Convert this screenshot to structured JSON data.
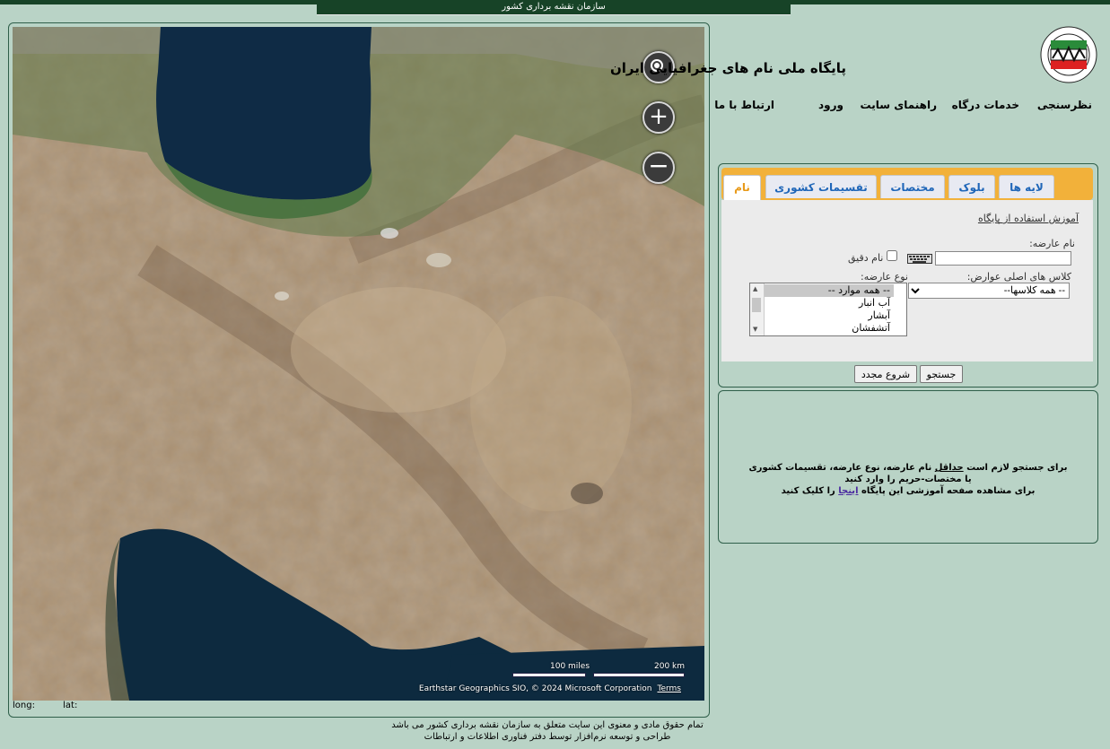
{
  "banner": {
    "agency": "سازمان نقشه برداری کشور"
  },
  "header": {
    "title": "پایگاه ملی نام های جغرافیایی ایران",
    "nav": [
      "نظرسنجی",
      "خدمات درگاه",
      "راهنمای سایت",
      "ورود",
      "ارتباط با ما"
    ]
  },
  "map": {
    "scale_miles": "100 miles",
    "scale_km": "200 km",
    "attribution": "Earthstar Geographics SIO, © 2024 Microsoft Corporation",
    "terms": "Terms",
    "zoom_in": "+",
    "zoom_out": "−",
    "long_label": "long:",
    "lat_label": "lat:"
  },
  "search": {
    "tabs": [
      "نام",
      "تقسیمات کشوری",
      "مختصات",
      "بلوک",
      "لایه ها"
    ],
    "active_tab": "نام",
    "help_link": "آموزش استفاده از پایگاه",
    "name_label": "نام عارضه:",
    "name_value": "",
    "exact_label": "نام دقیق",
    "exact_checked": false,
    "class_label": "کلاس های اصلی عوارض:",
    "class_selected": "-- همه کلاسها--",
    "type_label": "نوع عارضه:",
    "type_options": [
      "-- همه موارد --",
      "آب انبار",
      "آبشار",
      "آتشفشان"
    ],
    "search_button": "جستجو",
    "reset_button": "شروع مجدد"
  },
  "info": {
    "line1_a": "برای جستجو لازم است ",
    "line1_b": "حداقل",
    "line1_c": " نام عارضه، نوع عارضه، تقسیمات کشوری",
    "line2": "یا مختصات-حریم را وارد کنید",
    "line3_a": "برای مشاهده صفحه آموزشی این پایگاه ",
    "line3_link": "اینجا",
    "line3_b": " را کلیک کنید"
  },
  "footer": {
    "line1": "تمام حقوق مادی و معنوی این سایت متعلق به سازمان نقشه برداری کشور می باشد",
    "line2": "طراحی و توسعه نرم‌افزار توسط دفتر فناوری اطلاعات و ارتباطات"
  },
  "colors": {
    "page_bg": "#b9d3c6",
    "banner_bg": "#174327",
    "tab_bar": "#f2b13a",
    "tab_text": "#1f66b8",
    "active_tab_text": "#e89a1a"
  }
}
